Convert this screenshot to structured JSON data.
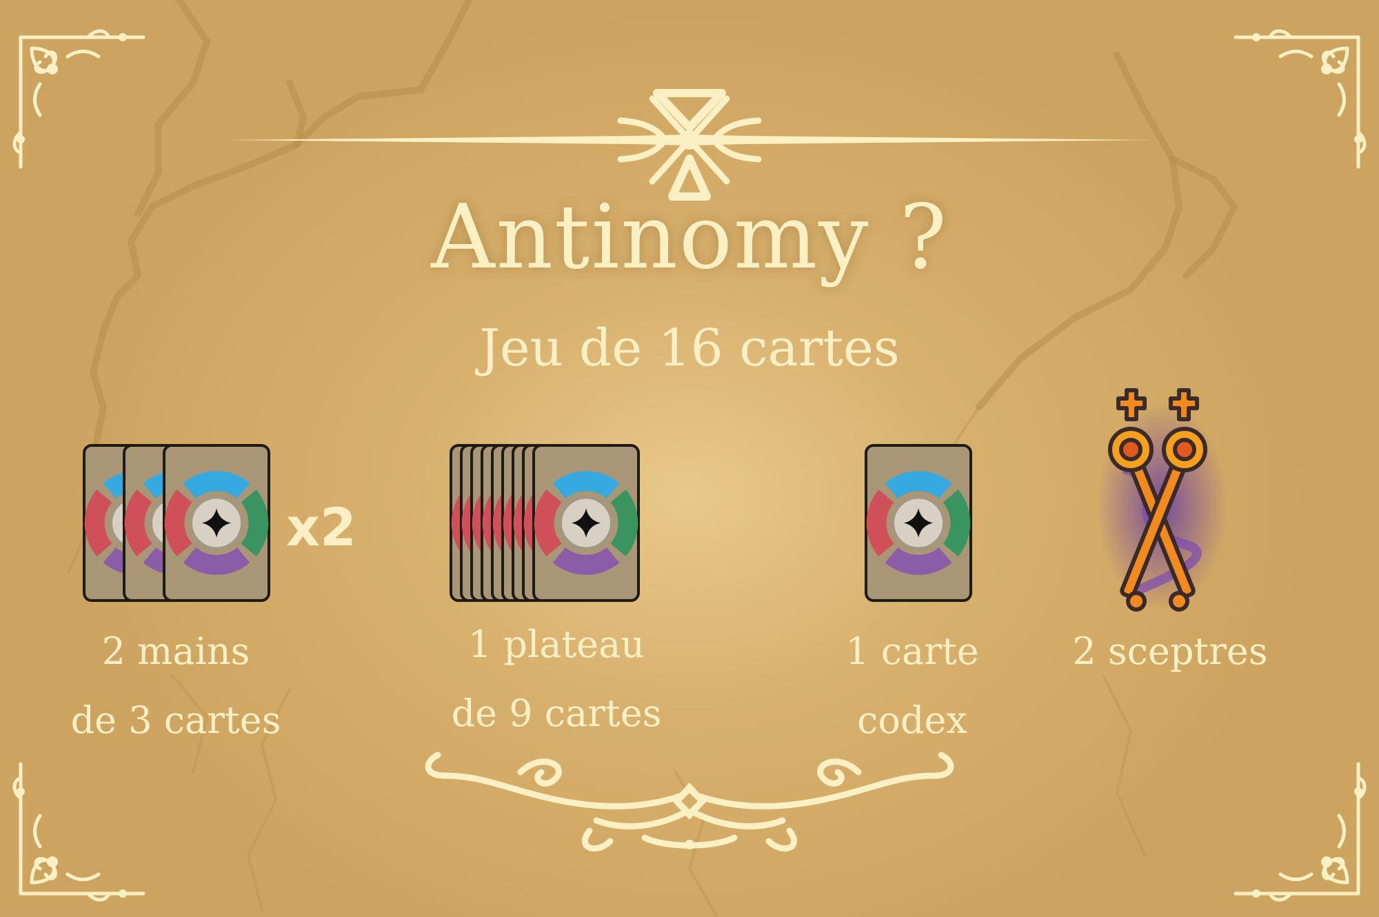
{
  "title": "Antinomy ?",
  "subtitle": "Jeu de 16 cartes",
  "components": [
    {
      "line1": "2 mains",
      "line2": "de 3 cartes",
      "multiplier": "x2",
      "card_count": 3
    },
    {
      "line1": "1 plateau",
      "line2": "de 9 cartes",
      "card_count": 9
    },
    {
      "line1": "1 carte",
      "line2": "codex",
      "card_count": 1
    },
    {
      "line1": "2 sceptres",
      "line2": ""
    }
  ],
  "icons": {
    "card_back": "card-back-icon",
    "scepters": "crossed-scepters-icon"
  },
  "colors": {
    "background": "#d6ac68",
    "text": "#fbefc6",
    "ornament": "#fbefc4",
    "card_fill": "#a89676",
    "ring_top": "#35a9e0",
    "ring_right": "#3a9460",
    "ring_bottom": "#8b5ca8",
    "ring_left": "#cf5058"
  }
}
